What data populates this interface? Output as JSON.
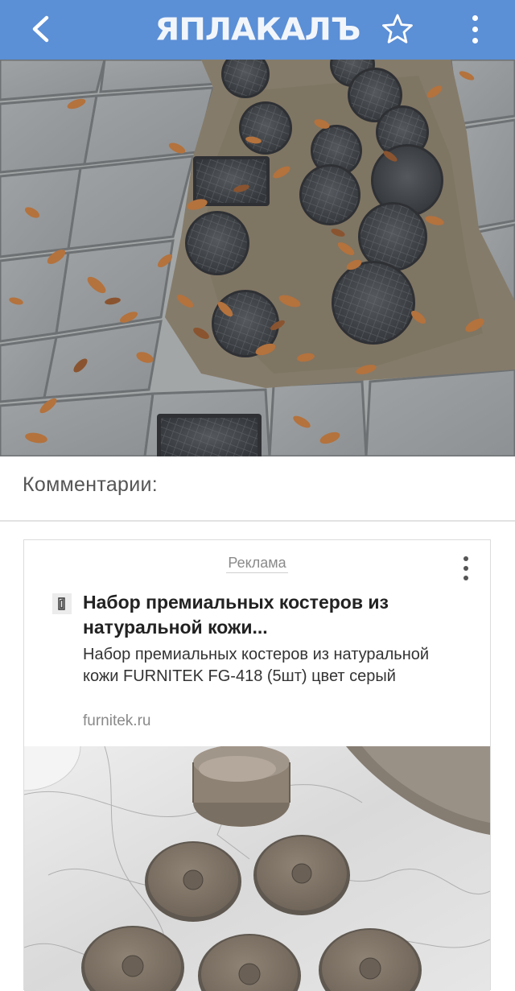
{
  "header": {
    "logo_text": "ЯПЛАКАЛЪ",
    "bg_color": "#5b8fd6",
    "icons": [
      "chevron-left-icon",
      "star-icon",
      "kebab-menu-icon"
    ]
  },
  "post": {
    "image_description": "Photo of paving stones with small round manhole covers and fallen autumn leaves"
  },
  "comments": {
    "title": "Комментарии:"
  },
  "ad": {
    "label": "Реклама",
    "headline": "Набор премиальных костеров из натуральной кожи...",
    "description": "Набор премиальных костеров из натуральной кожи FURNITEK FG-418 (5шт) цвет серый",
    "domain": "furnitek.ru",
    "image_description": "Leather coasters on marble table"
  }
}
